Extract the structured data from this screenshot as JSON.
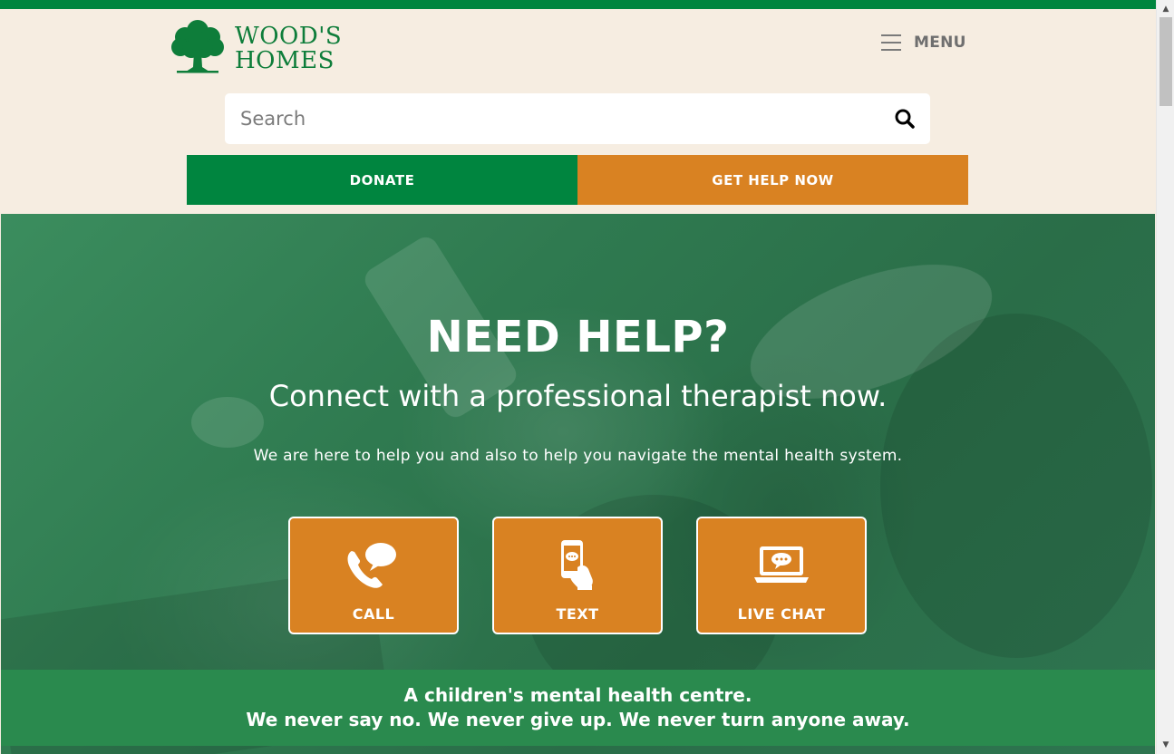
{
  "brand": {
    "name_line1": "WOOD'S",
    "name_line2": "HOMES",
    "logo_icon": "tree-icon",
    "colors": {
      "green": "#00853f",
      "orange": "#d98222",
      "cream": "#f6ede1"
    }
  },
  "header": {
    "menu_label": "MENU",
    "menu_icon": "hamburger-icon"
  },
  "search": {
    "placeholder": "Search",
    "value": "",
    "icon": "search-icon"
  },
  "cta": {
    "donate_label": "DONATE",
    "get_help_label": "GET HELP NOW"
  },
  "hero": {
    "title": "NEED HELP?",
    "subtitle": "Connect with a professional therapist now.",
    "description": "We are here to help you and also to help you navigate the mental health system.",
    "options": [
      {
        "label": "CALL",
        "icon": "phone-chat-icon"
      },
      {
        "label": "TEXT",
        "icon": "mobile-message-icon"
      },
      {
        "label": "LIVE CHAT",
        "icon": "laptop-chat-icon"
      }
    ]
  },
  "tagline": {
    "line1": "A children's mental health centre.",
    "line2": "We never say no. We never give up. We never turn anyone away."
  }
}
